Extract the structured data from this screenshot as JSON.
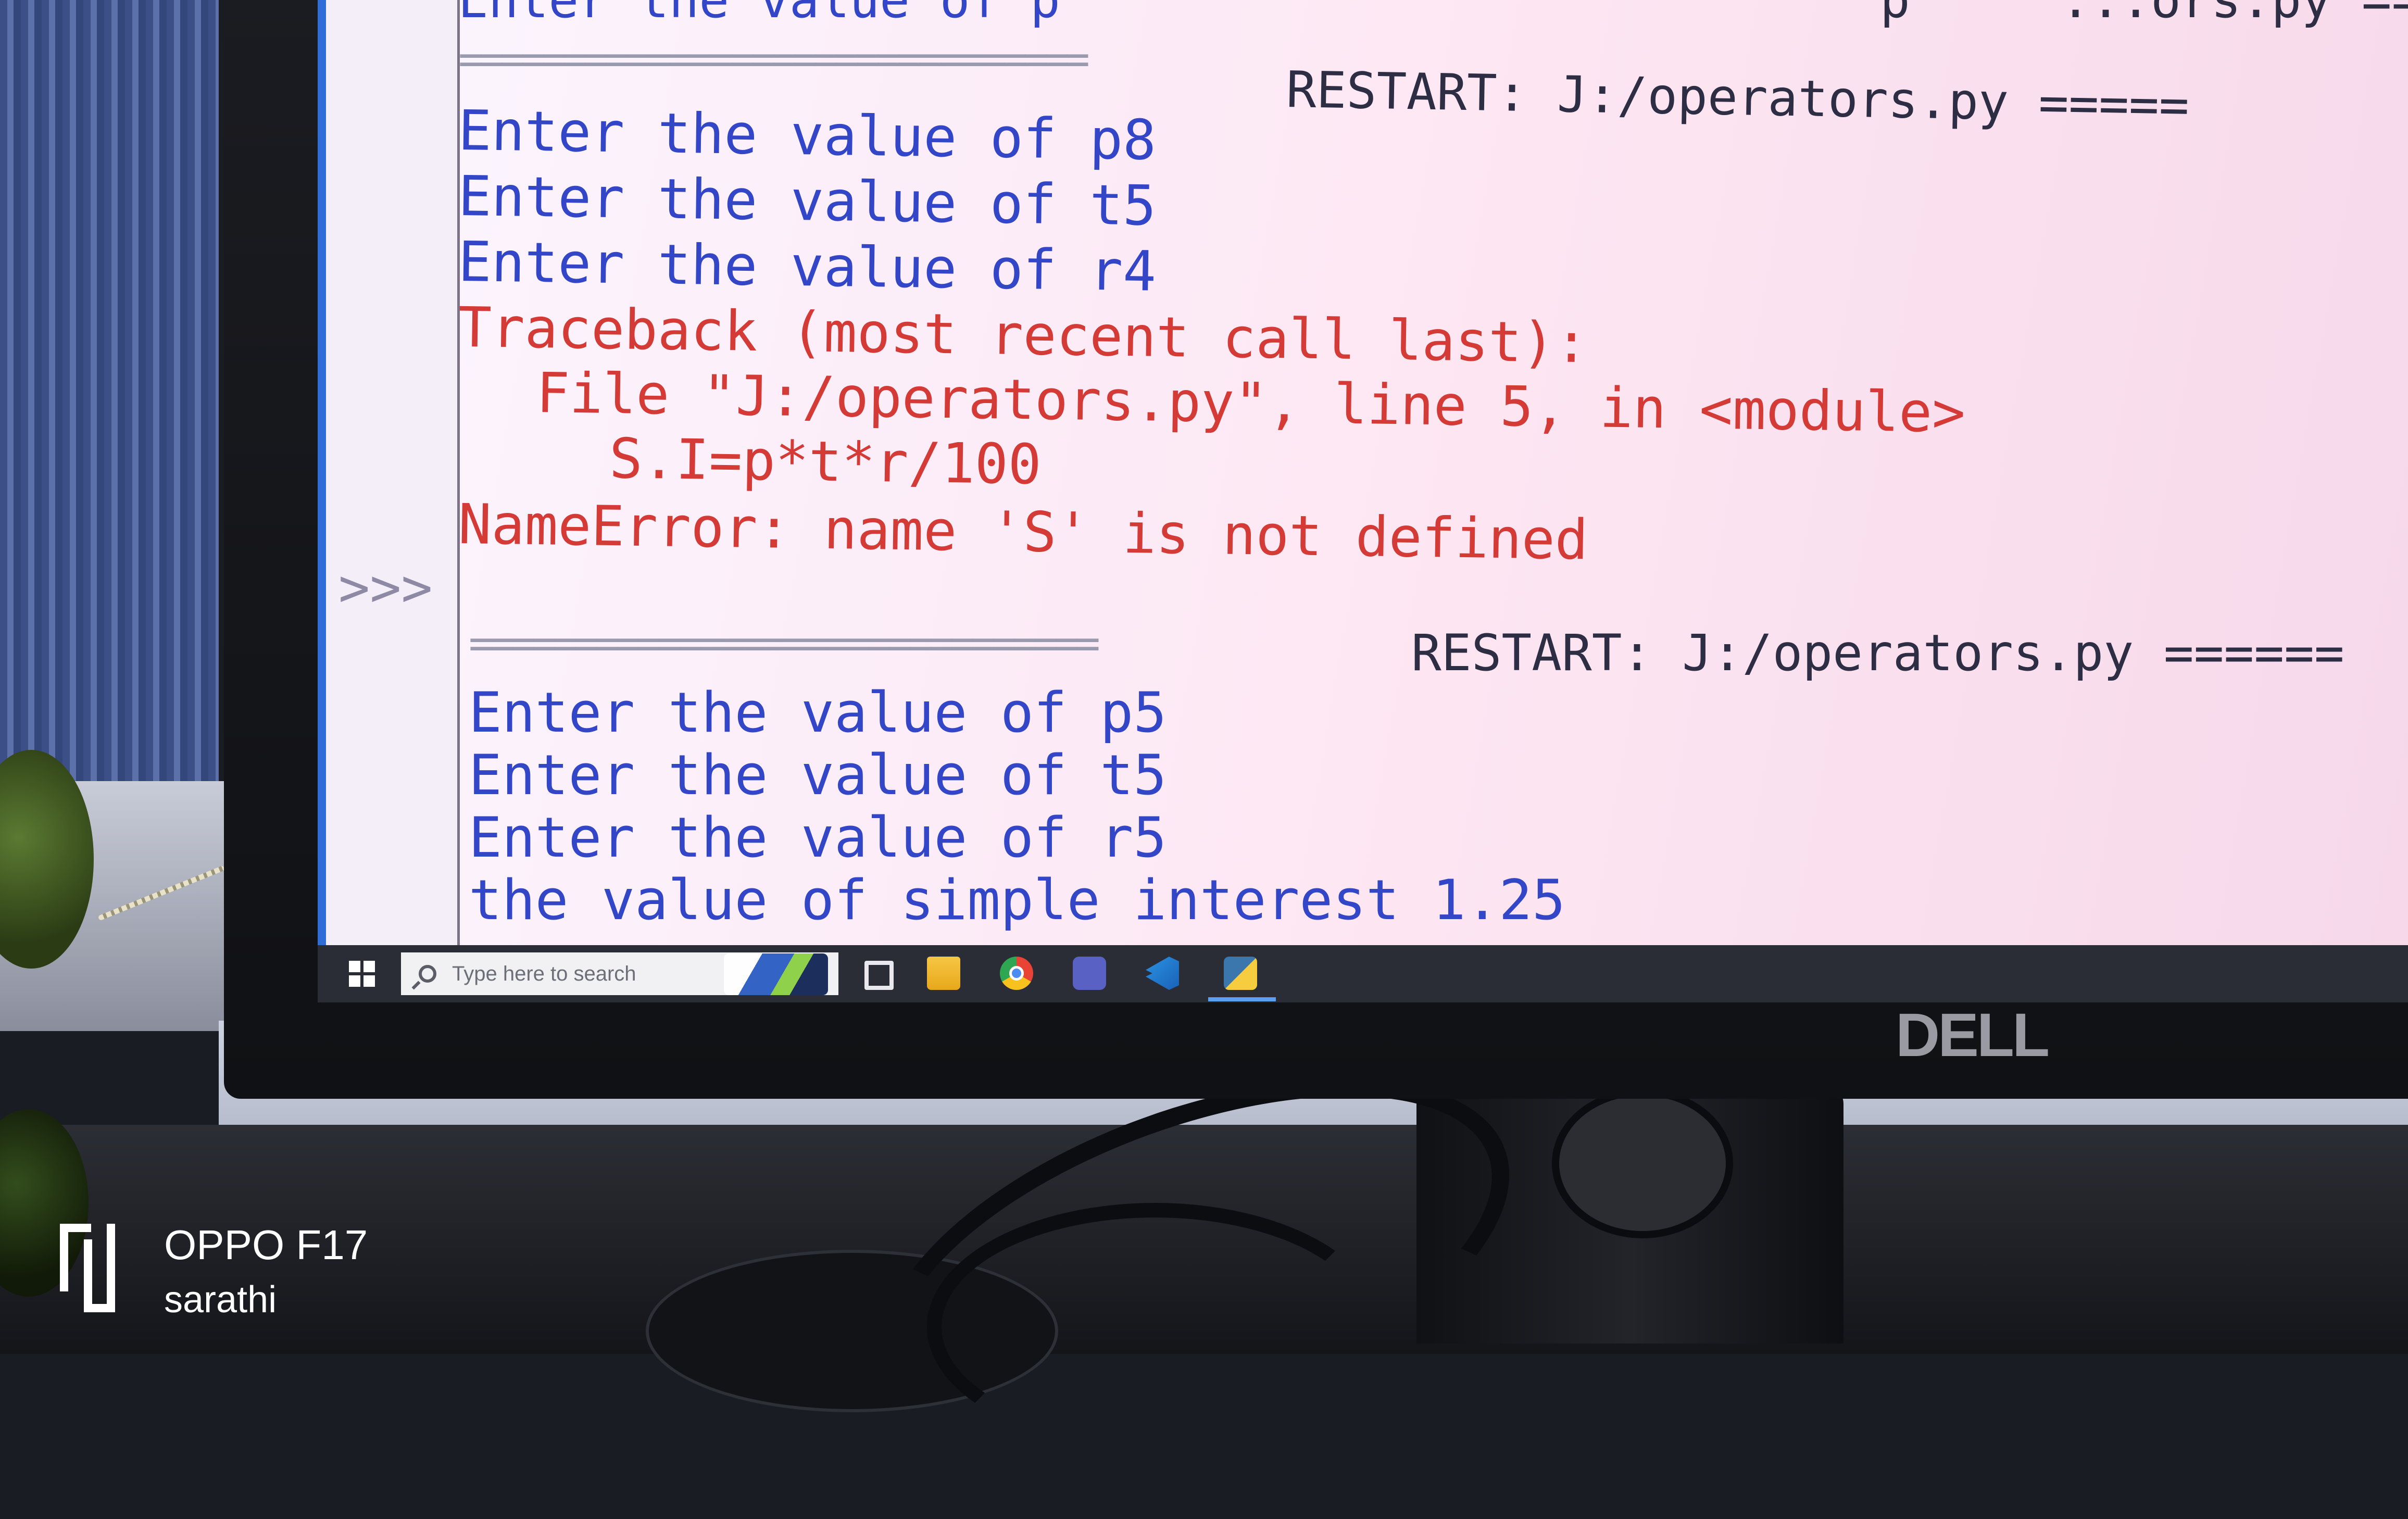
{
  "shell": {
    "top_partial": "Enter the value of p",
    "top_partial_right": "p     ...ors.py ====",
    "ruler_text": "==============================",
    "restart_1": "RESTART: J:/operators.py =====",
    "restart_2": "RESTART: J:/operators.py ======",
    "run1": [
      "Enter the value of p8",
      "Enter the value of t5",
      "Enter the value of r4"
    ],
    "traceback": {
      "header": "Traceback (most recent call last):",
      "file_line": "File \"J:/operators.py\", line 5, in <module>",
      "code_line": "S.I=p*t*r/100",
      "error_line": "NameError: name 'S' is not defined"
    },
    "prompt": ">>>",
    "run2": [
      "Enter the value of p5",
      "Enter the value of t5",
      "Enter the value of r5",
      "the value of simple interest 1.25"
    ]
  },
  "taskbar": {
    "search_placeholder": "Type here to search",
    "icons": [
      "windows-start-icon",
      "search-icon",
      "news-weather-icon",
      "task-view-icon",
      "file-explorer-icon",
      "chrome-icon",
      "teams-icon",
      "vscode-icon",
      "python-idle-icon"
    ]
  },
  "monitor": {
    "brand": "DELL"
  },
  "watermark": {
    "device": "OPPO F17",
    "user": "sarathi"
  },
  "colors": {
    "input_prompt": "#3346c8",
    "error": "#d43a36",
    "taskbar": "#2a2d36"
  }
}
